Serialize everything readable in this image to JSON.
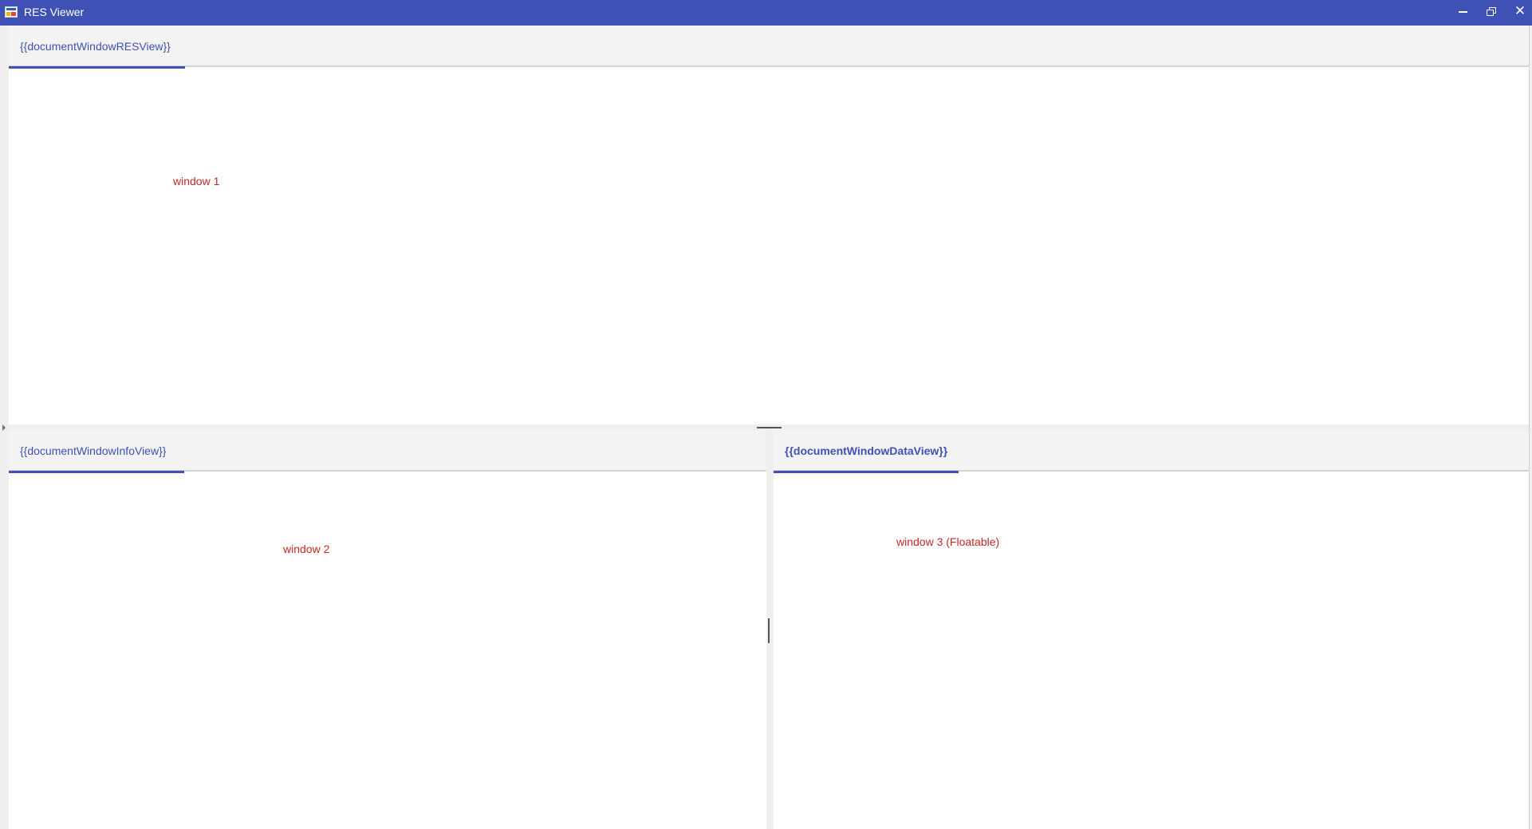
{
  "window": {
    "title": "RES Viewer",
    "icon": "app-icon",
    "controls": {
      "minimize_icon": "minimize-icon",
      "maximize_icon": "restore-icon",
      "close_glyph": "✕"
    }
  },
  "colors": {
    "titlebar": "#3f51b5",
    "tab_text": "#3f51b5",
    "content_label": "#c62828"
  },
  "panes": {
    "top": {
      "tab_label": "{{documentWindowRESView}}",
      "content_label": "window 1"
    },
    "bottom_left": {
      "tab_label": "{{documentWindowInfoView}}",
      "content_label": "window 2"
    },
    "bottom_right": {
      "tab_label": "{{documentWindowDataView}}",
      "content_label": "window 3 (Floatable)"
    }
  }
}
